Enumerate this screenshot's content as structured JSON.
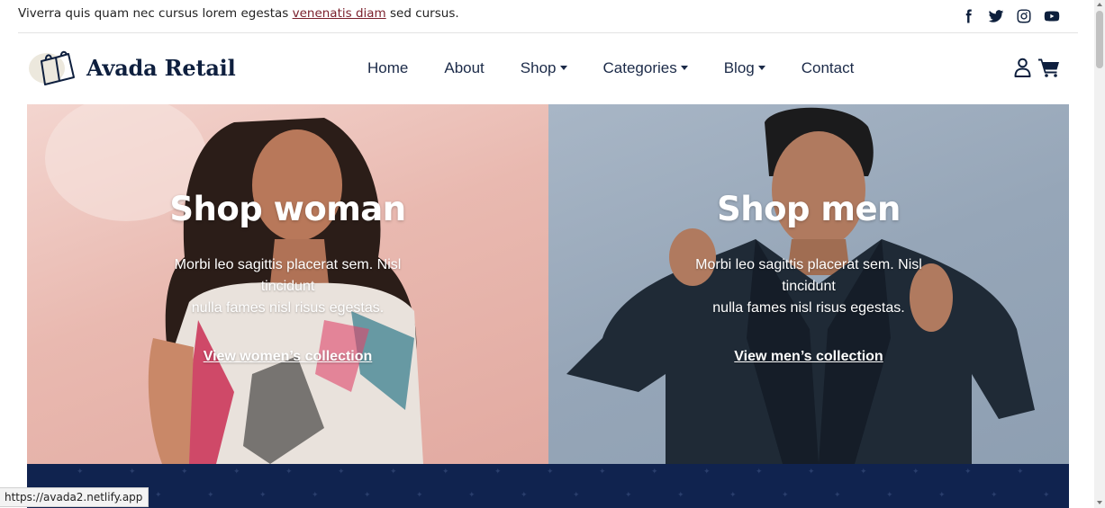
{
  "topbar": {
    "text_before": "Viverra quis quam nec cursus lorem egestas ",
    "link": "venenatis diam",
    "text_after": " sed cursus.",
    "socials": [
      "facebook-icon",
      "twitter-icon",
      "instagram-icon",
      "youtube-icon"
    ]
  },
  "header": {
    "brand": "Avada Retail",
    "nav": {
      "home": "Home",
      "about": "About",
      "shop": "Shop",
      "categories": "Categories",
      "blog": "Blog",
      "contact": "Contact"
    },
    "icons": [
      "user-icon",
      "cart-icon"
    ]
  },
  "hero": {
    "women": {
      "title": "Shop woman",
      "desc_line1": "Morbi leo sagittis placerat sem. Nisl tincidunt",
      "desc_line2": "nulla fames nisl risus egestas.",
      "link": "View women’s collection"
    },
    "men": {
      "title": "Shop men",
      "desc_line1": "Morbi leo sagittis placerat sem. Nisl tincidunt",
      "desc_line2": "nulla fames nisl risus egestas.",
      "link": "View men’s collection"
    }
  },
  "status_url": "https://avada2.netlify.app",
  "colors": {
    "brand_navy": "#0e1f3e",
    "band": "#10234f",
    "link_red": "#7a1f2b"
  }
}
